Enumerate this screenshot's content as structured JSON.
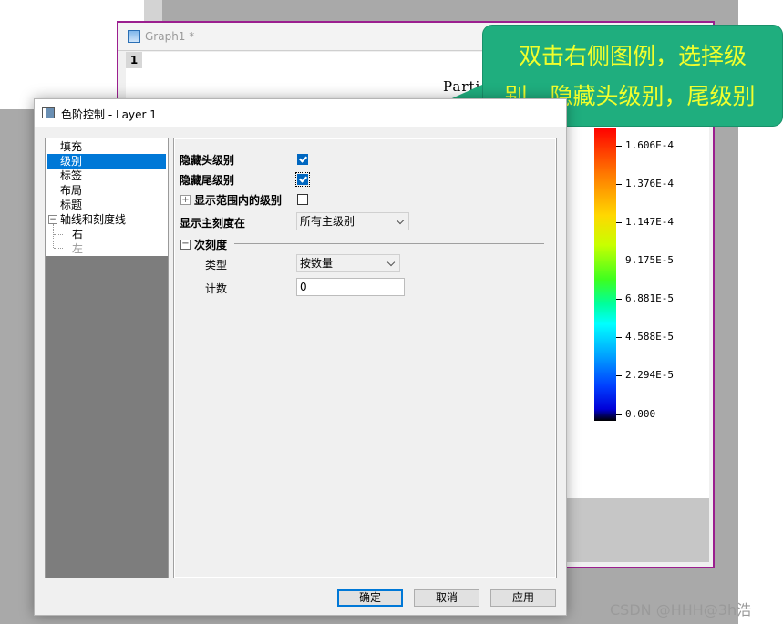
{
  "graph_window": {
    "title": "Graph1 *",
    "layer_tag": "1",
    "partial_title": "Partic"
  },
  "colorbar": {
    "labels": [
      "1.606E-4",
      "1.376E-4",
      "1.147E-4",
      "9.175E-5",
      "6.881E-5",
      "4.588E-5",
      "2.294E-5",
      "0.000"
    ],
    "colors": [
      "#ff0000",
      "#ff7a00",
      "#ffd800",
      "#3cff20",
      "#00ffff",
      "#00a0ff",
      "#0000d8",
      "#000000"
    ]
  },
  "callout": {
    "line1": "双击右侧图例，选择级",
    "line2": "别，隐藏头级别，尾级别",
    "bg_color": "#1fae7e",
    "text_color": "#f2ff2c"
  },
  "dialog": {
    "title": "色阶控制 - Layer 1",
    "tree": {
      "items": [
        "填充",
        "级别",
        "标签",
        "布局",
        "标题",
        "轴线和刻度线",
        "右",
        "左"
      ],
      "selected": "级别"
    },
    "panel": {
      "hide_head_level": {
        "label": "隐藏头级别",
        "checked": true
      },
      "hide_tail_level": {
        "label": "隐藏尾级别",
        "checked": true
      },
      "show_levels_in_range": {
        "label": "显示范围内的级别",
        "checked": false
      },
      "show_major_ticks_at": {
        "label": "显示主刻度在",
        "value": "所有主级别"
      },
      "minor_ticks": {
        "group_label": "次刻度",
        "type_label": "类型",
        "type_value": "按数量",
        "count_label": "计数",
        "count_value": "0"
      }
    },
    "buttons": {
      "ok": "确定",
      "cancel": "取消",
      "apply": "应用"
    }
  },
  "watermark": "CSDN @HHH@3h浩"
}
